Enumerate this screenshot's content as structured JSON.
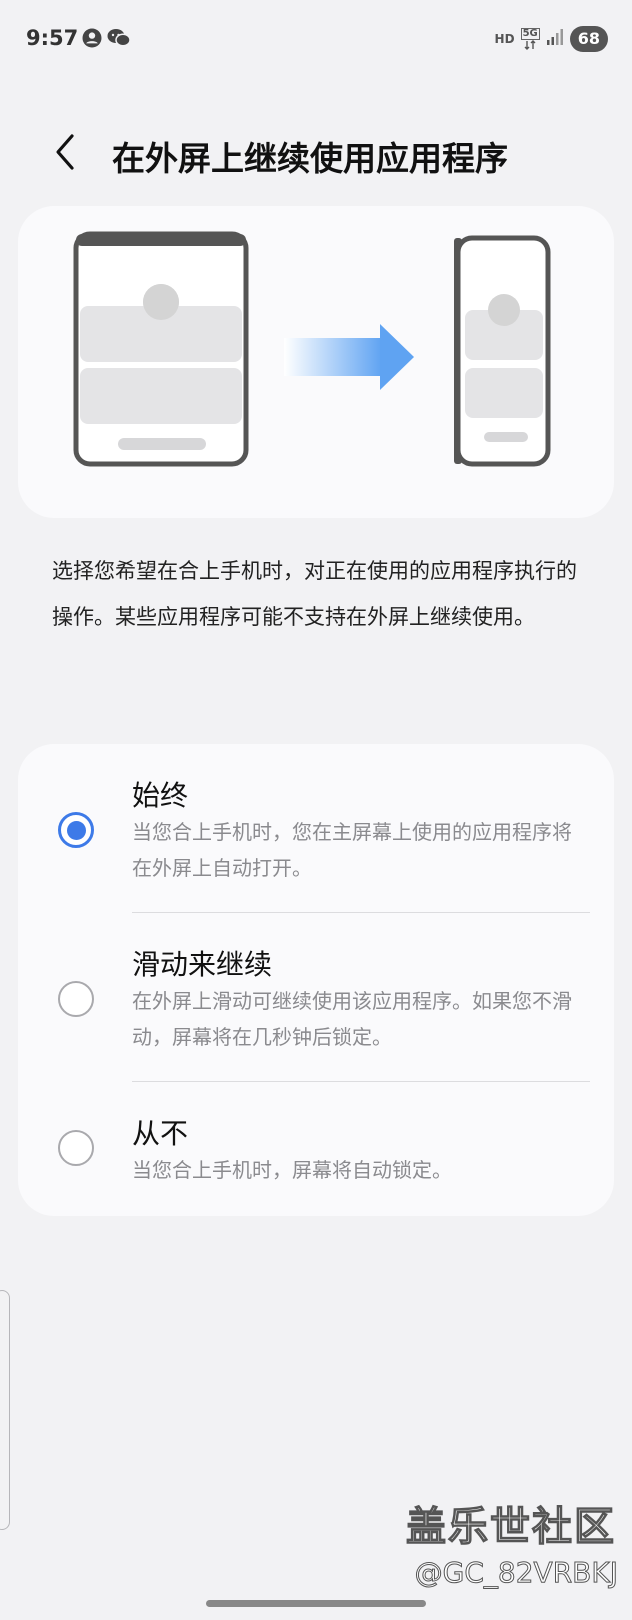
{
  "status_bar": {
    "time": "9:57",
    "left_icons": [
      "account-icon",
      "wechat-icon"
    ],
    "network": "HD",
    "signal_type": "5G",
    "battery": "68"
  },
  "header": {
    "back_icon": "chevron-left-icon",
    "title": "在外屏上继续使用应用程序"
  },
  "illustration": {
    "icons": [
      "unfolded-phone-icon",
      "arrow-right-icon",
      "folded-phone-icon"
    ]
  },
  "description": "选择您希望在合上手机时，对正在使用的应用程序执行的操作。某些应用程序可能不支持在外屏上继续使用。",
  "options": [
    {
      "title": "始终",
      "subtitle": "当您合上手机时，您在主屏幕上使用的应用程序将在外屏上自动打开。",
      "selected": true
    },
    {
      "title": "滑动来继续",
      "subtitle": "在外屏上滑动可继续使用该应用程序。如果您不滑动，屏幕将在几秒钟后锁定。",
      "selected": false
    },
    {
      "title": "从不",
      "subtitle": "当您合上手机时，屏幕将自动锁定。",
      "selected": false
    }
  ],
  "watermark": {
    "brand": "盖乐世社区",
    "user": "@GC_82VRBKJ"
  },
  "colors": {
    "background": "#f2f2f4",
    "card": "#fafafc",
    "accent": "#3d7ae8",
    "secondary_text": "#8a8a8e"
  }
}
